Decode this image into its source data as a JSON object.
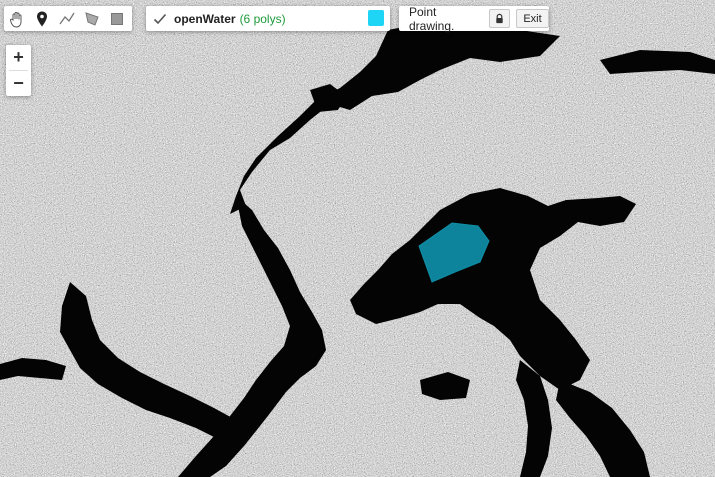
{
  "toolbar": {
    "tools": [
      {
        "icon": "hand-icon"
      },
      {
        "icon": "marker-icon"
      },
      {
        "icon": "polyline-icon"
      },
      {
        "icon": "polygon-icon"
      },
      {
        "icon": "rectangle-icon"
      }
    ]
  },
  "layer": {
    "checked": true,
    "name": "openWater",
    "count_text": "(6 polys)",
    "color": "#1ed5f5"
  },
  "drawing": {
    "status": "Point drawing.",
    "lock_icon": "lock-icon",
    "exit_label": "Exit"
  },
  "zoom": {
    "in_label": "+",
    "out_label": "−"
  },
  "map": {
    "polygon_fill": "#0e8fa8"
  }
}
